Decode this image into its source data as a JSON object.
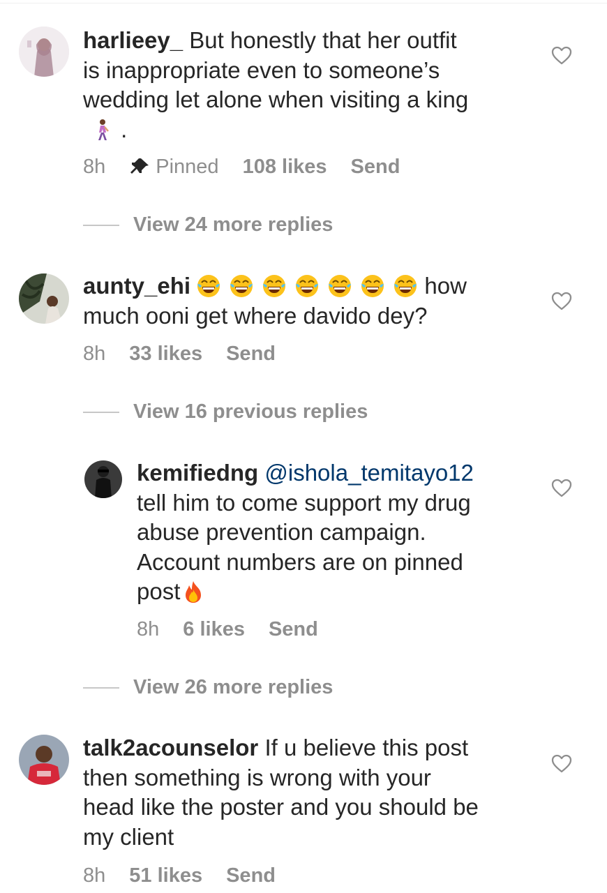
{
  "comments": [
    {
      "username": "harlieey_",
      "text_lines": [
        "But honestly that her outfit",
        "is inappropriate even to someone’s",
        "wedding let alone when visiting a king"
      ],
      "trailing": ".",
      "time": "8h",
      "pinned_label": "Pinned",
      "likes": "108 likes",
      "send": "Send",
      "view_more": "View 24 more replies"
    },
    {
      "username": "aunty_ehi",
      "text_after_emoji": "how",
      "text_line2": "much ooni get where davido dey?",
      "time": "8h",
      "likes": "33 likes",
      "send": "Send",
      "view_more": "View 16 previous replies"
    },
    {
      "username": "kemifiedng",
      "mention": "@ishola_temitayo12",
      "text_lines": [
        "tell him to come support my drug",
        "abuse prevention campaign.",
        "Account numbers are on pinned",
        "post"
      ],
      "time": "8h",
      "likes": "6 likes",
      "send": "Send",
      "view_more": "View 26 more replies"
    },
    {
      "username": "talk2acounselor",
      "text_first": "If u believe this post",
      "text_lines": [
        "then something is wrong with your",
        "head like the poster and you should be",
        "my client"
      ],
      "time": "8h",
      "likes": "51 likes",
      "send": "Send"
    }
  ],
  "icons": {
    "heart": "heart-outline-icon",
    "pin": "pin-icon",
    "laugh_emoji": "face-with-tears-of-joy",
    "fire_emoji": "fire",
    "walk_emoji": "person-walking"
  },
  "colors": {
    "text": "#262626",
    "secondary": "#8e8e8e",
    "mention": "#00376b"
  }
}
